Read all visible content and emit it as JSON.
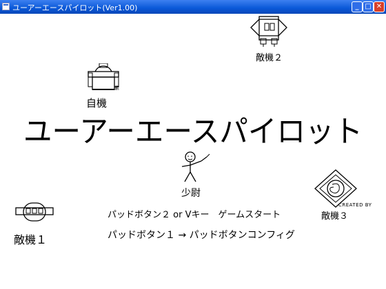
{
  "window": {
    "title": "ユーアーエースパイロット(Ver1.00)",
    "minimize_icon": "minimize-icon",
    "maximize_icon": "maximize-icon",
    "close_icon": "close-icon"
  },
  "game": {
    "title": "ユーアーエースパイロット",
    "player_label": "自機",
    "enemy1_label": "敵機１",
    "enemy2_label": "敵機２",
    "enemy3_label": "敵機３",
    "pilot_label": "少尉",
    "instruction_start": "パッドボタン２ or Vキー　ゲームスタート",
    "instruction_config": "パッドボタン１ → パッドボタンコンフィグ",
    "credit": "CREATED BY"
  }
}
